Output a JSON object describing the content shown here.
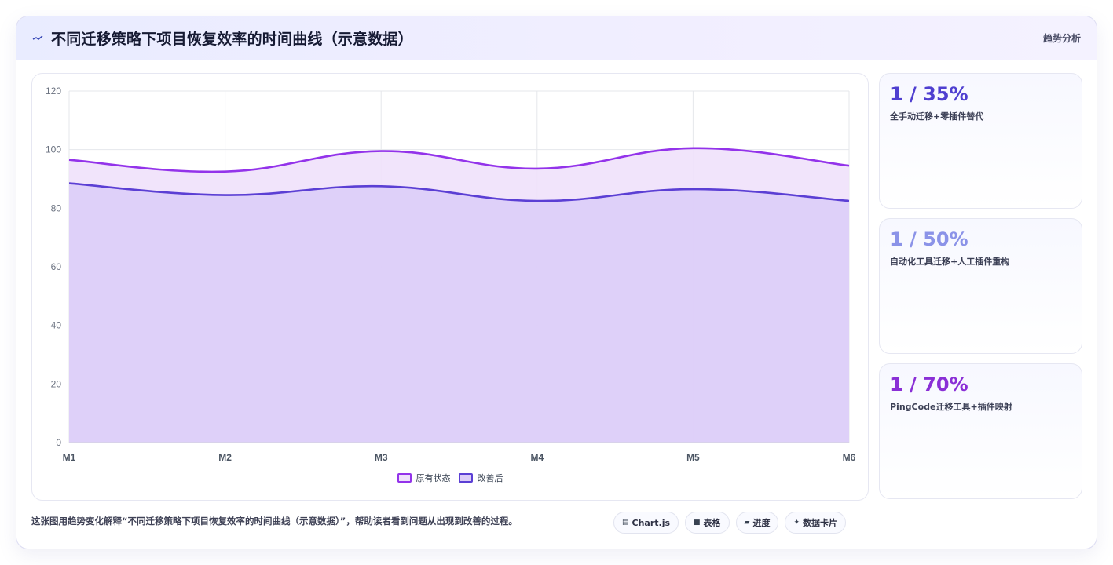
{
  "header": {
    "title": "不同迁移策略下项目恢复效率的时间曲线（示意数据）",
    "tag": "趋势分析",
    "icon": "trend-icon"
  },
  "chart_data": {
    "type": "area",
    "x": [
      "M1",
      "M2",
      "M3",
      "M4",
      "M5",
      "M6"
    ],
    "series": [
      {
        "name": "原有状态",
        "values": [
          96.5,
          92.5,
          99.5,
          93.5,
          100.5,
          94.5
        ],
        "color": "#9333ea",
        "fill": "#efe1fb"
      },
      {
        "name": "改善后",
        "values": [
          88.5,
          84.5,
          87.5,
          82.5,
          86.5,
          82.5
        ],
        "color": "#5b3fd4",
        "fill": "#dccdf8"
      }
    ],
    "ylim": [
      0,
      120
    ],
    "yticks": [
      0,
      20,
      40,
      60,
      80,
      100,
      120
    ],
    "grid": true,
    "legend": "bottom"
  },
  "stats": [
    {
      "value": "1 / 35%",
      "label": "全手动迁移+零插件替代",
      "color": "#4f3fd0"
    },
    {
      "value": "1 / 50%",
      "label": "自动化工具迁移+人工插件重构",
      "color": "#8b93e8"
    },
    {
      "value": "1 / 70%",
      "label": "PingCode迁移工具+插件映射",
      "color": "#8a2fd6"
    }
  ],
  "footer": {
    "text": "这张图用趋势变化解释“不同迁移策略下项目恢复效率的时间曲线（示意数据）”，帮助读者看到问题从出现到改善的过程。",
    "chips": [
      {
        "icon": "▤",
        "label": "Chart.js"
      },
      {
        "icon": "■",
        "label": "表格"
      },
      {
        "icon": "▰",
        "label": "进度"
      },
      {
        "icon": "✦",
        "label": "数据卡片"
      }
    ]
  }
}
